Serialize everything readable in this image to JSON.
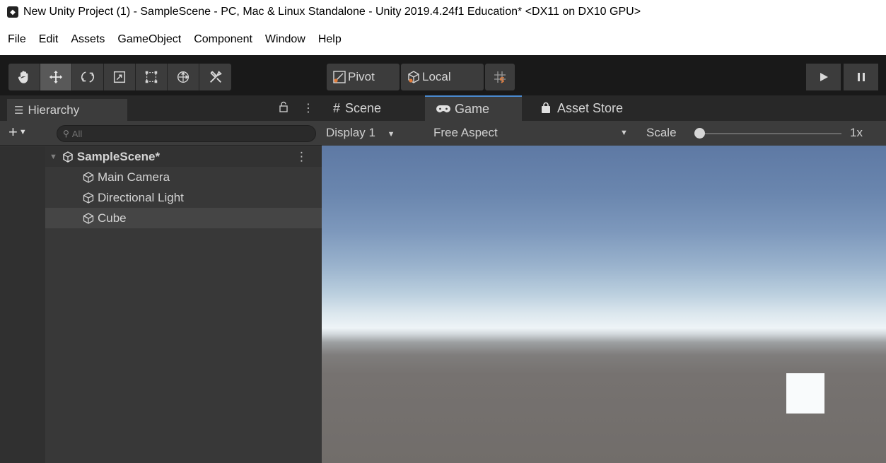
{
  "window": {
    "title": "New Unity Project (1) - SampleScene - PC, Mac & Linux Standalone - Unity 2019.4.24f1 Education* <DX11 on DX10 GPU>"
  },
  "menu": [
    "File",
    "Edit",
    "Assets",
    "GameObject",
    "Component",
    "Window",
    "Help"
  ],
  "toolbar": {
    "tools": [
      "hand-tool-icon",
      "move-tool-icon",
      "rotate-tool-icon",
      "scale-tool-icon",
      "rect-tool-icon",
      "transform-tool-icon",
      "custom-tool-icon"
    ],
    "active_tool": "move-tool-icon",
    "pivot_label": "Pivot",
    "local_label": "Local"
  },
  "hierarchy": {
    "tab_label": "Hierarchy",
    "search_placeholder": "All",
    "scene": "SampleScene*",
    "objects": [
      "Main Camera",
      "Directional Light",
      "Cube"
    ],
    "hovered_object": "Cube"
  },
  "game_panel": {
    "tabs": [
      "Scene",
      "Game",
      "Asset Store"
    ],
    "active_tab": "Game",
    "display": "Display 1",
    "aspect": "Free Aspect",
    "scale_label": "Scale",
    "scale_value": "1x"
  },
  "colors": {
    "toolbar_bg": "#191919",
    "panel_bg": "#383838",
    "active_tab_accent": "#4a8ad0"
  }
}
